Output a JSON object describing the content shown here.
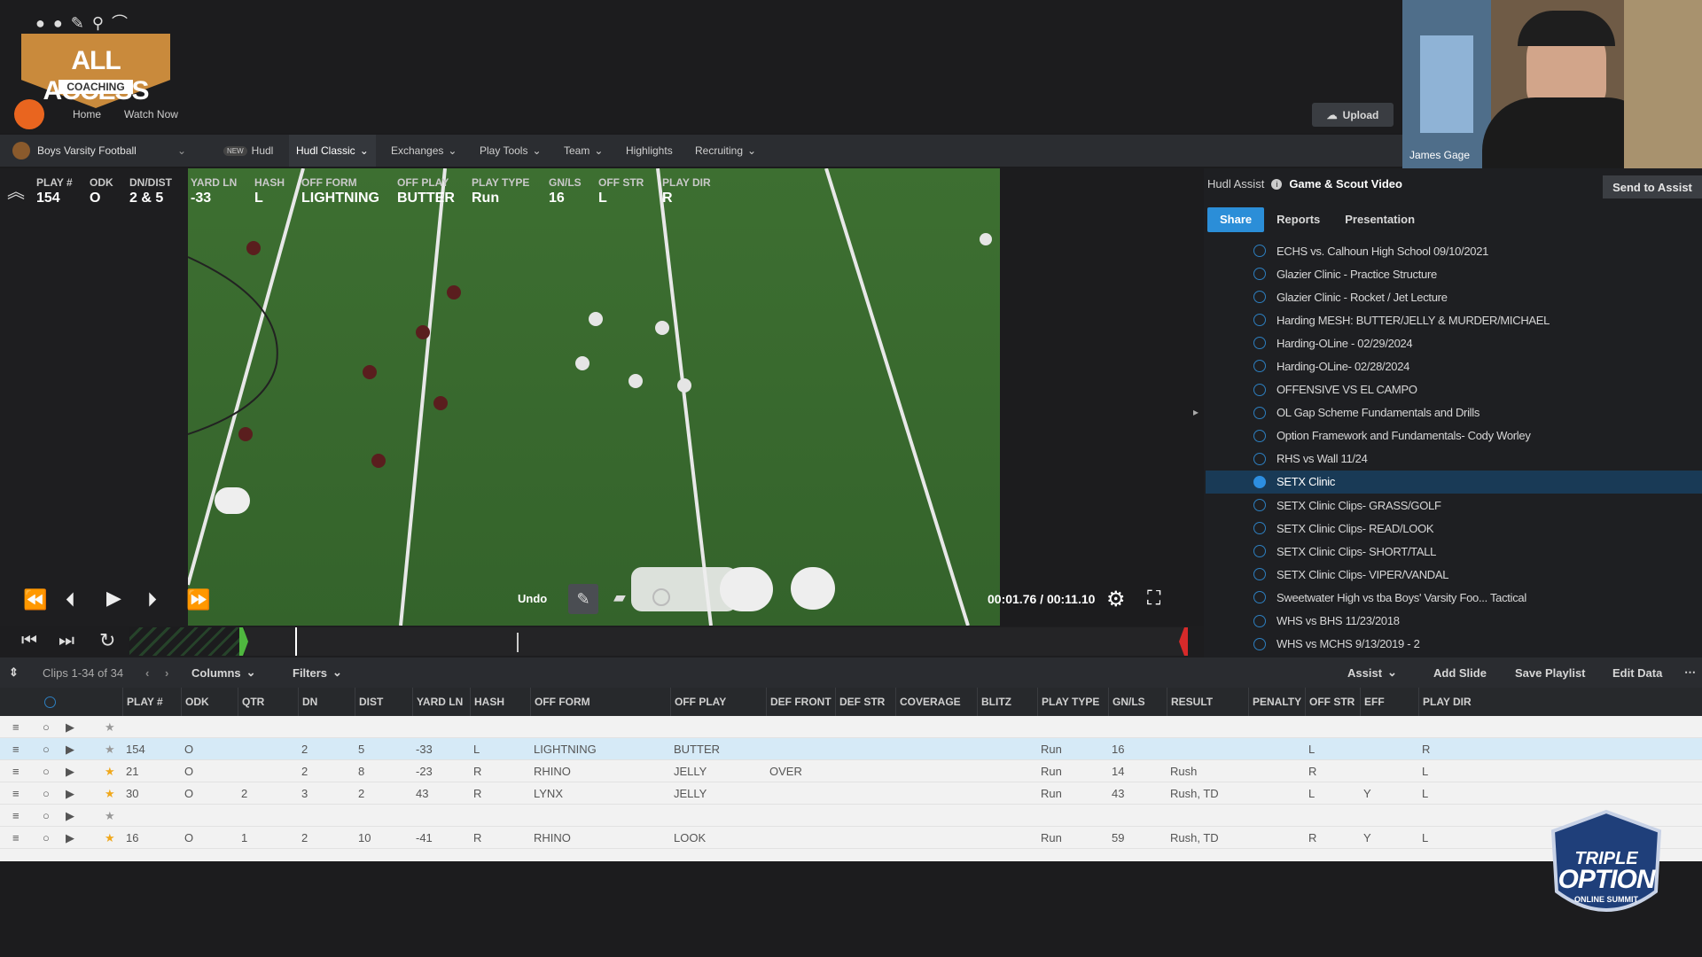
{
  "header": {
    "brand_title": "ALL ACCESS",
    "brand_subtitle": "COACHING",
    "nav": [
      "Home",
      "Watch Now"
    ],
    "upload_label": "Upload"
  },
  "teambar": {
    "team": "Boys Varsity Football",
    "new_badge": "NEW",
    "tabs": [
      "Hudl",
      "Hudl Classic",
      "Exchanges",
      "Play Tools",
      "Team",
      "Highlights",
      "Recruiting"
    ]
  },
  "play_meta": {
    "labels": [
      "PLAY #",
      "ODK",
      "DN/DIST",
      "YARD LN",
      "HASH",
      "OFF FORM",
      "OFF PLAY",
      "PLAY TYPE",
      "GN/LS",
      "OFF STR",
      "PLAY DIR"
    ],
    "values": [
      "154",
      "O",
      "2 & 5",
      "-33",
      "L",
      "LIGHTNING",
      "BUTTER",
      "Run",
      "16",
      "L",
      "R"
    ]
  },
  "player": {
    "undo_label": "Undo",
    "timecode": "00:01.76 / 00:11.10"
  },
  "assist": {
    "label": "Hudl Assist",
    "title": "Game & Scout Video",
    "send_label": "Send to Assist",
    "tabs": [
      "Share",
      "Reports",
      "Presentation"
    ],
    "videos": [
      "ECHS vs. Calhoun High School 09/10/2021",
      "Glazier Clinic - Practice Structure",
      "Glazier Clinic - Rocket / Jet Lecture",
      "Harding MESH: BUTTER/JELLY & MURDER/MICHAEL",
      "Harding-OLine - 02/29/2024",
      "Harding-OLine- 02/28/2024",
      "OFFENSIVE VS EL CAMPO",
      "OL Gap Scheme Fundamentals and Drills",
      "Option Framework and Fundamentals- Cody Worley",
      "RHS vs Wall 11/24",
      "SETX Clinic",
      "SETX Clinic Clips- GRASS/GOLF",
      "SETX Clinic Clips- READ/LOOK",
      "SETX Clinic Clips- SHORT/TALL",
      "SETX Clinic Clips- VIPER/VANDAL",
      "Sweetwater High vs tba Boys' Varsity Foo... Tactical",
      "WHS vs BHS 11/23/2018",
      "WHS vs MCHS 9/13/2019 - 2"
    ],
    "selected_index": 10
  },
  "webcam": {
    "name": "James Gage"
  },
  "table_toolbar": {
    "clips_count": "Clips 1-34 of 34",
    "columns_label": "Columns",
    "filters_label": "Filters",
    "assist_label": "Assist",
    "add_slide": "Add Slide",
    "save_playlist": "Save Playlist",
    "edit_data": "Edit Data"
  },
  "table": {
    "columns": [
      "PLAY #",
      "ODK",
      "QTR",
      "DN",
      "DIST",
      "YARD LN",
      "HASH",
      "OFF FORM",
      "OFF PLAY",
      "DEF FRONT",
      "DEF STR",
      "COVERAGE",
      "BLITZ",
      "PLAY TYPE",
      "GN/LS",
      "RESULT",
      "PENALTY",
      "OFF STR",
      "EFF",
      "PLAY DIR"
    ],
    "rows": [
      {
        "starred": false,
        "cells": [
          "",
          "",
          "",
          "",
          "",
          "",
          "",
          "",
          "",
          "",
          "",
          "",
          "",
          "",
          "",
          "",
          "",
          "",
          "",
          ""
        ]
      },
      {
        "starred": false,
        "highlight": true,
        "cells": [
          "154",
          "O",
          "",
          "2",
          "5",
          "-33",
          "L",
          "LIGHTNING",
          "BUTTER",
          "",
          "",
          "",
          "",
          "Run",
          "16",
          "",
          "",
          "L",
          "",
          "R"
        ]
      },
      {
        "starred": true,
        "cells": [
          "21",
          "O",
          "",
          "2",
          "8",
          "-23",
          "R",
          "RHINO",
          "JELLY",
          "OVER",
          "",
          "",
          "",
          "Run",
          "14",
          "Rush",
          "",
          "R",
          "",
          "L"
        ]
      },
      {
        "starred": true,
        "cells": [
          "30",
          "O",
          "2",
          "3",
          "2",
          "43",
          "R",
          "LYNX",
          "JELLY",
          "",
          "",
          "",
          "",
          "Run",
          "43",
          "Rush, TD",
          "",
          "L",
          "Y",
          "L"
        ]
      },
      {
        "starred": false,
        "cells": [
          "",
          "",
          "",
          "",
          "",
          "",
          "",
          "",
          "",
          "",
          "",
          "",
          "",
          "",
          "",
          "",
          "",
          "",
          "",
          ""
        ]
      },
      {
        "starred": true,
        "cells": [
          "16",
          "O",
          "1",
          "2",
          "10",
          "-41",
          "R",
          "RHINO",
          "LOOK",
          "",
          "",
          "",
          "",
          "Run",
          "59",
          "Rush, TD",
          "",
          "R",
          "Y",
          "L"
        ]
      }
    ]
  },
  "overlay_logo": {
    "line1": "TRIPLE",
    "line2": "OPTION",
    "line3": "ONLINE SUMMIT"
  },
  "colors": {
    "accent": "#2b8ed8",
    "brand_orange": "#c98a3c",
    "field": "#3a6b2f"
  }
}
